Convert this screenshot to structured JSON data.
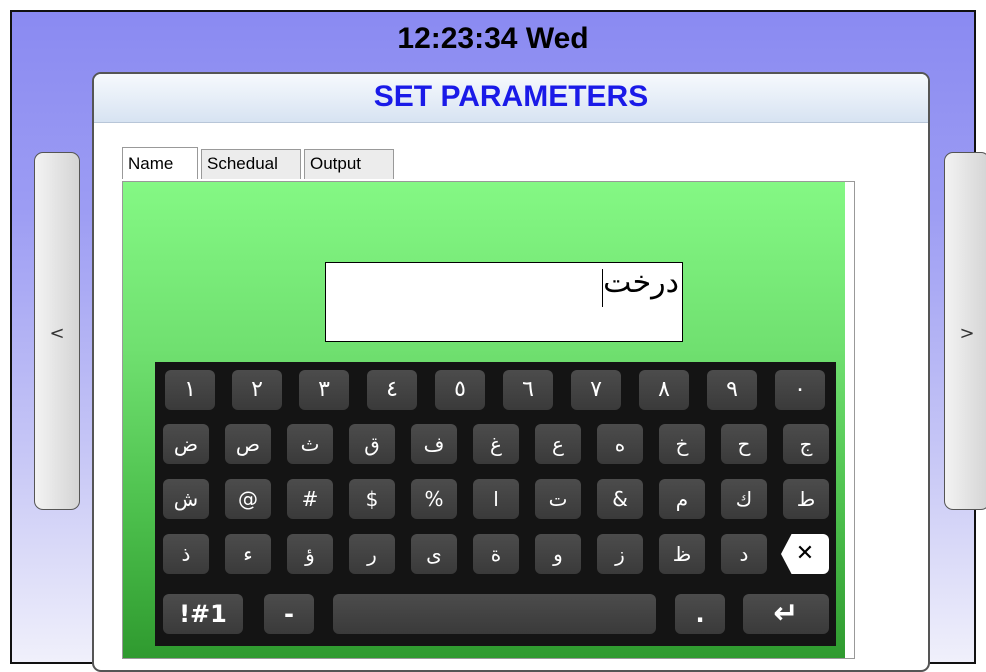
{
  "clock": "12:23:34 Wed",
  "nav": {
    "left": "<",
    "right": ">"
  },
  "panel": {
    "title": "SET PARAMETERS"
  },
  "tabs": [
    "Name",
    "Schedual",
    "Output"
  ],
  "name_input": {
    "value": "درخت"
  },
  "keyboard": {
    "row1": [
      "١",
      "٢",
      "٣",
      "٤",
      "٥",
      "٦",
      "٧",
      "٨",
      "٩",
      "٠"
    ],
    "row2": [
      "ض",
      "ص",
      "ث",
      "ق",
      "ف",
      "غ",
      "ع",
      "ه",
      "خ",
      "ح",
      "ج"
    ],
    "row3": [
      "ش",
      "@",
      "#",
      "$",
      "%",
      "ا",
      "ت",
      "&",
      "م",
      "ك",
      "ط"
    ],
    "row4": [
      "ذ",
      "ء",
      "ؤ",
      "ر",
      "ى",
      "ة",
      "و",
      "ز",
      "ظ",
      "د"
    ],
    "delete_key": "✕",
    "row5": {
      "symbols": "!#1",
      "dash": "-",
      "space": "",
      "period": ".",
      "enter": "↵"
    }
  }
}
